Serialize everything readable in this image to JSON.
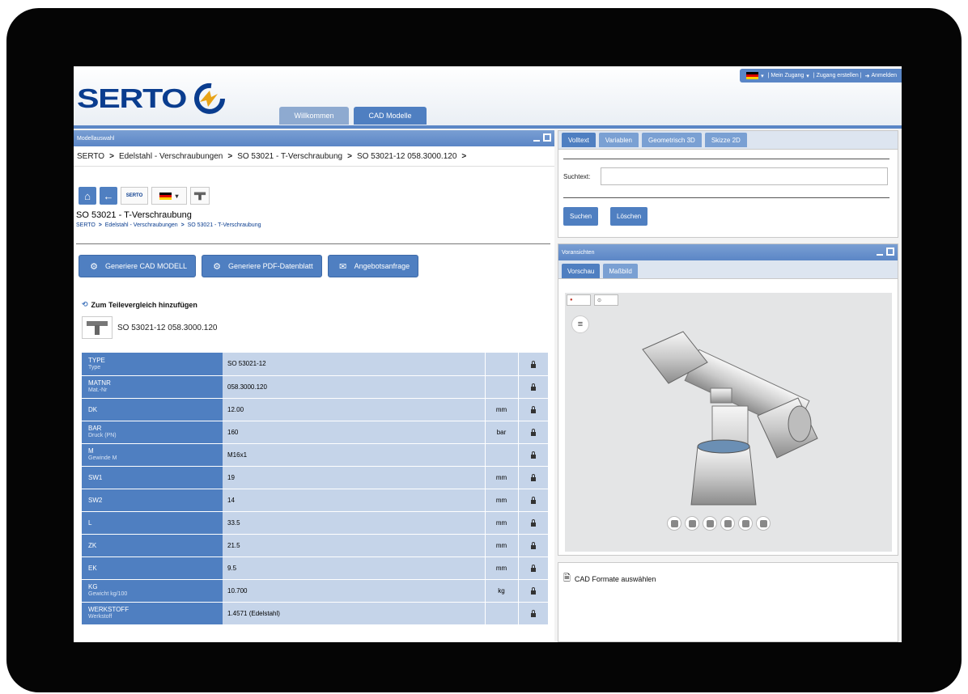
{
  "header": {
    "logo_text": "SERTO",
    "tabs": [
      "Willkommen",
      "CAD Modelle"
    ],
    "active_tab": 1,
    "topbar": {
      "account": "Mein Zugang",
      "create": "Zugang erstellen",
      "login": "Anmelden"
    }
  },
  "model_panel": {
    "title": "Modellauswahl",
    "breadcrumb": [
      "SERTO",
      "Edelstahl - Verschraubungen",
      "SO 53021 - T-Verschraubung",
      "SO 53021-12 058.3000.120"
    ],
    "product_title": "SO 53021 - T-Verschraubung",
    "product_crumb": [
      "SERTO",
      "Edelstahl - Verschraubungen",
      "SO 53021 - T-Verschraubung"
    ],
    "actions": [
      "Generiere CAD MODELL",
      "Generiere PDF-Datenblatt",
      "Angebotsanfrage"
    ],
    "compare_label": "Zum Teilevergleich hinzufügen",
    "part_label": "SO 53021-12 058.3000.120",
    "rows": [
      {
        "key": "TYPE",
        "sub": "Type",
        "value": "SO 53021-12",
        "unit": ""
      },
      {
        "key": "MATNR",
        "sub": "Mat.-Nr",
        "value": "058.3000.120",
        "unit": ""
      },
      {
        "key": "DK",
        "sub": "",
        "value": "12.00",
        "unit": "mm"
      },
      {
        "key": "BAR",
        "sub": "Druck (PN)",
        "value": "160",
        "unit": "bar"
      },
      {
        "key": "M",
        "sub": "Gewinde M",
        "value": "M16x1",
        "unit": ""
      },
      {
        "key": "SW1",
        "sub": "",
        "value": "19",
        "unit": "mm"
      },
      {
        "key": "SW2",
        "sub": "",
        "value": "14",
        "unit": "mm"
      },
      {
        "key": "L",
        "sub": "",
        "value": "33.5",
        "unit": "mm"
      },
      {
        "key": "ZK",
        "sub": "",
        "value": "21.5",
        "unit": "mm"
      },
      {
        "key": "EK",
        "sub": "",
        "value": "9.5",
        "unit": "mm"
      },
      {
        "key": "KG",
        "sub": "Gewicht kg/100",
        "value": "10.700",
        "unit": "kg"
      },
      {
        "key": "WERKSTOFF",
        "sub": "Werkstoff",
        "value": "1.4571 (Edelstahl)",
        "unit": ""
      }
    ]
  },
  "search_panel": {
    "tabs": [
      "Volltext",
      "Variablen",
      "Geometrisch 3D",
      "Skizze 2D"
    ],
    "label": "Suchtext:",
    "value": "",
    "search_button": "Suchen",
    "clear_button": "Löschen"
  },
  "preview_panel": {
    "title": "Voransichten",
    "tabs": [
      "Vorschau",
      "Maßbild"
    ]
  },
  "cad_panel": {
    "label": "CAD Formate auswählen"
  }
}
